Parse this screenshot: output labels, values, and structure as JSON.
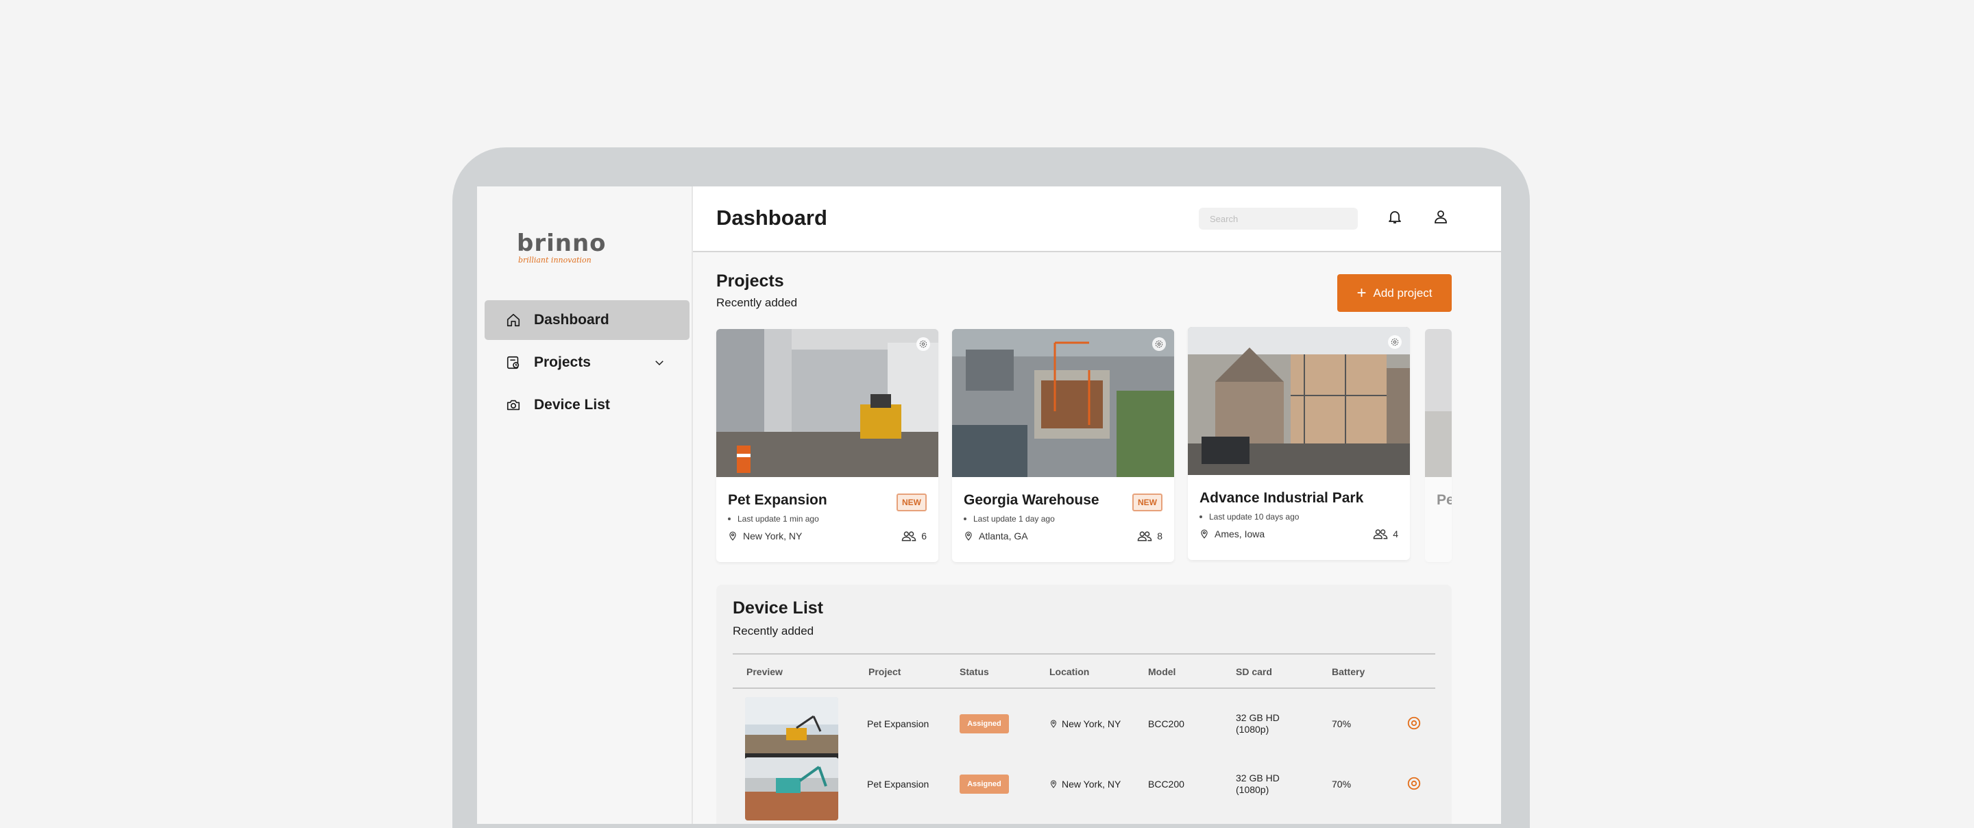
{
  "brand": {
    "logo_word_a": "bri",
    "logo_word_b": "nno",
    "tagline": "brilliant innovation"
  },
  "sidebar": {
    "items": [
      {
        "label": "Dashboard",
        "icon": "home-icon",
        "active": true
      },
      {
        "label": "Projects",
        "icon": "project-folder-icon",
        "expandable": true
      },
      {
        "label": "Device List",
        "icon": "camera-icon"
      }
    ]
  },
  "header": {
    "title": "Dashboard",
    "search_placeholder": "Search"
  },
  "projects": {
    "title": "Projects",
    "subtitle": "Recently added",
    "add_button": "Add project",
    "cards": [
      {
        "name": "Pet Expansion",
        "badge": "NEW",
        "updated": "Last update 1 min ago",
        "location": "New York, NY",
        "members": "6"
      },
      {
        "name": "Georgia Warehouse",
        "badge": "NEW",
        "updated": "Last update 1 day ago",
        "location": "Atlanta, GA",
        "members": "8"
      },
      {
        "name": "Advance Industrial Park",
        "updated": "Last update 10 days ago",
        "location": "Ames, Iowa",
        "members": "4"
      },
      {
        "name": "Pe"
      }
    ]
  },
  "devices": {
    "title": "Device List",
    "subtitle": "Recently added",
    "columns": [
      "Preview",
      "Project",
      "Status",
      "Location",
      "Model",
      "SD card",
      "Battery"
    ],
    "rows": [
      {
        "project": "Pet Expansion",
        "status": "Assigned",
        "location": "New York, NY",
        "model": "BCC200",
        "sd_line1": "32 GB HD",
        "sd_line2": "(1080p)",
        "battery": "70%"
      },
      {
        "project": "Pet Expansion",
        "status": "Assigned",
        "location": "New York, NY",
        "model": "BCC200",
        "sd_line1": "32 GB HD",
        "sd_line2": "(1080p)",
        "battery": "70%"
      }
    ]
  },
  "colors": {
    "accent": "#e3701d",
    "badge_border": "#e7a17a",
    "active_nav": "#cccccc"
  }
}
